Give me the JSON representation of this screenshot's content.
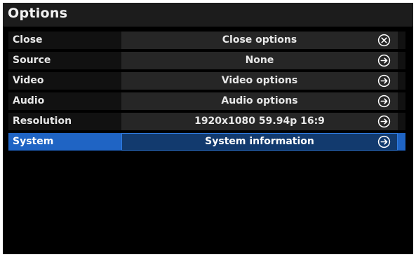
{
  "window": {
    "title": "Options"
  },
  "rows": [
    {
      "label": "Close",
      "value": "Close options",
      "icon": "close-circle-icon"
    },
    {
      "label": "Source",
      "value": "None",
      "icon": "arrow-right-circle-icon"
    },
    {
      "label": "Video",
      "value": "Video options",
      "icon": "arrow-right-circle-icon"
    },
    {
      "label": "Audio",
      "value": "Audio options",
      "icon": "arrow-right-circle-icon"
    },
    {
      "label": "Resolution",
      "value": "1920x1080 59.94p 16:9",
      "icon": "arrow-right-circle-icon"
    },
    {
      "label": "System",
      "value": "System information",
      "icon": "arrow-right-circle-icon",
      "selected": true
    }
  ],
  "colors": {
    "background": "#000000",
    "title_bar": "#1c1c1c",
    "row": "#111111",
    "value_box": "#262626",
    "selection": "#1f64c4",
    "selected_value_box": "#123a6e",
    "text": "#e8e8e8"
  }
}
